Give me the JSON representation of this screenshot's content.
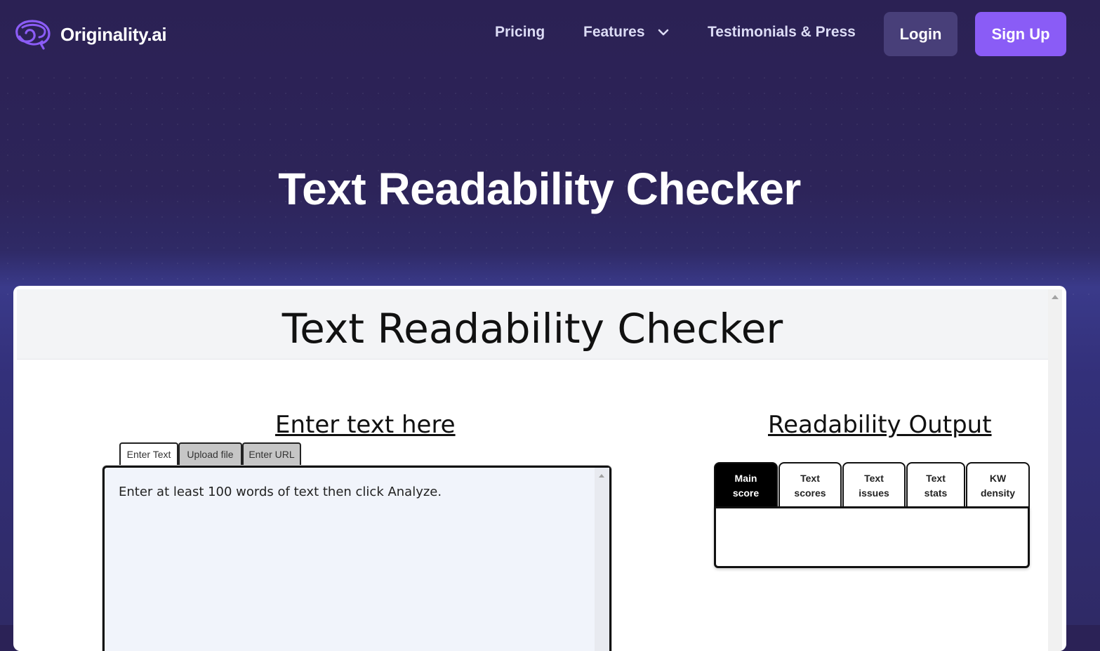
{
  "brand": {
    "name": "Originality.ai",
    "logo_icon": "brain-logo-icon",
    "accent_color": "#8a5cf6"
  },
  "nav": {
    "pricing": "Pricing",
    "features": "Features",
    "testimonials": "Testimonials & Press",
    "login": "Login",
    "signup": "Sign Up"
  },
  "hero": {
    "title": "Text Readability Checker"
  },
  "tool": {
    "title": "Text Readability Checker",
    "input_heading": "Enter text here",
    "input_tabs": [
      "Enter Text",
      "Upload file",
      "Enter URL"
    ],
    "input_active_tab": "Enter Text",
    "textarea_placeholder": "Enter at least 100 words of text then click Analyze.",
    "output_heading": "Readability Output",
    "output_tabs": [
      "Main\nscore",
      "Text\nscores",
      "Text\nissues",
      "Text\nstats",
      "KW\ndensity"
    ],
    "output_active_tab": "Main\nscore"
  }
}
